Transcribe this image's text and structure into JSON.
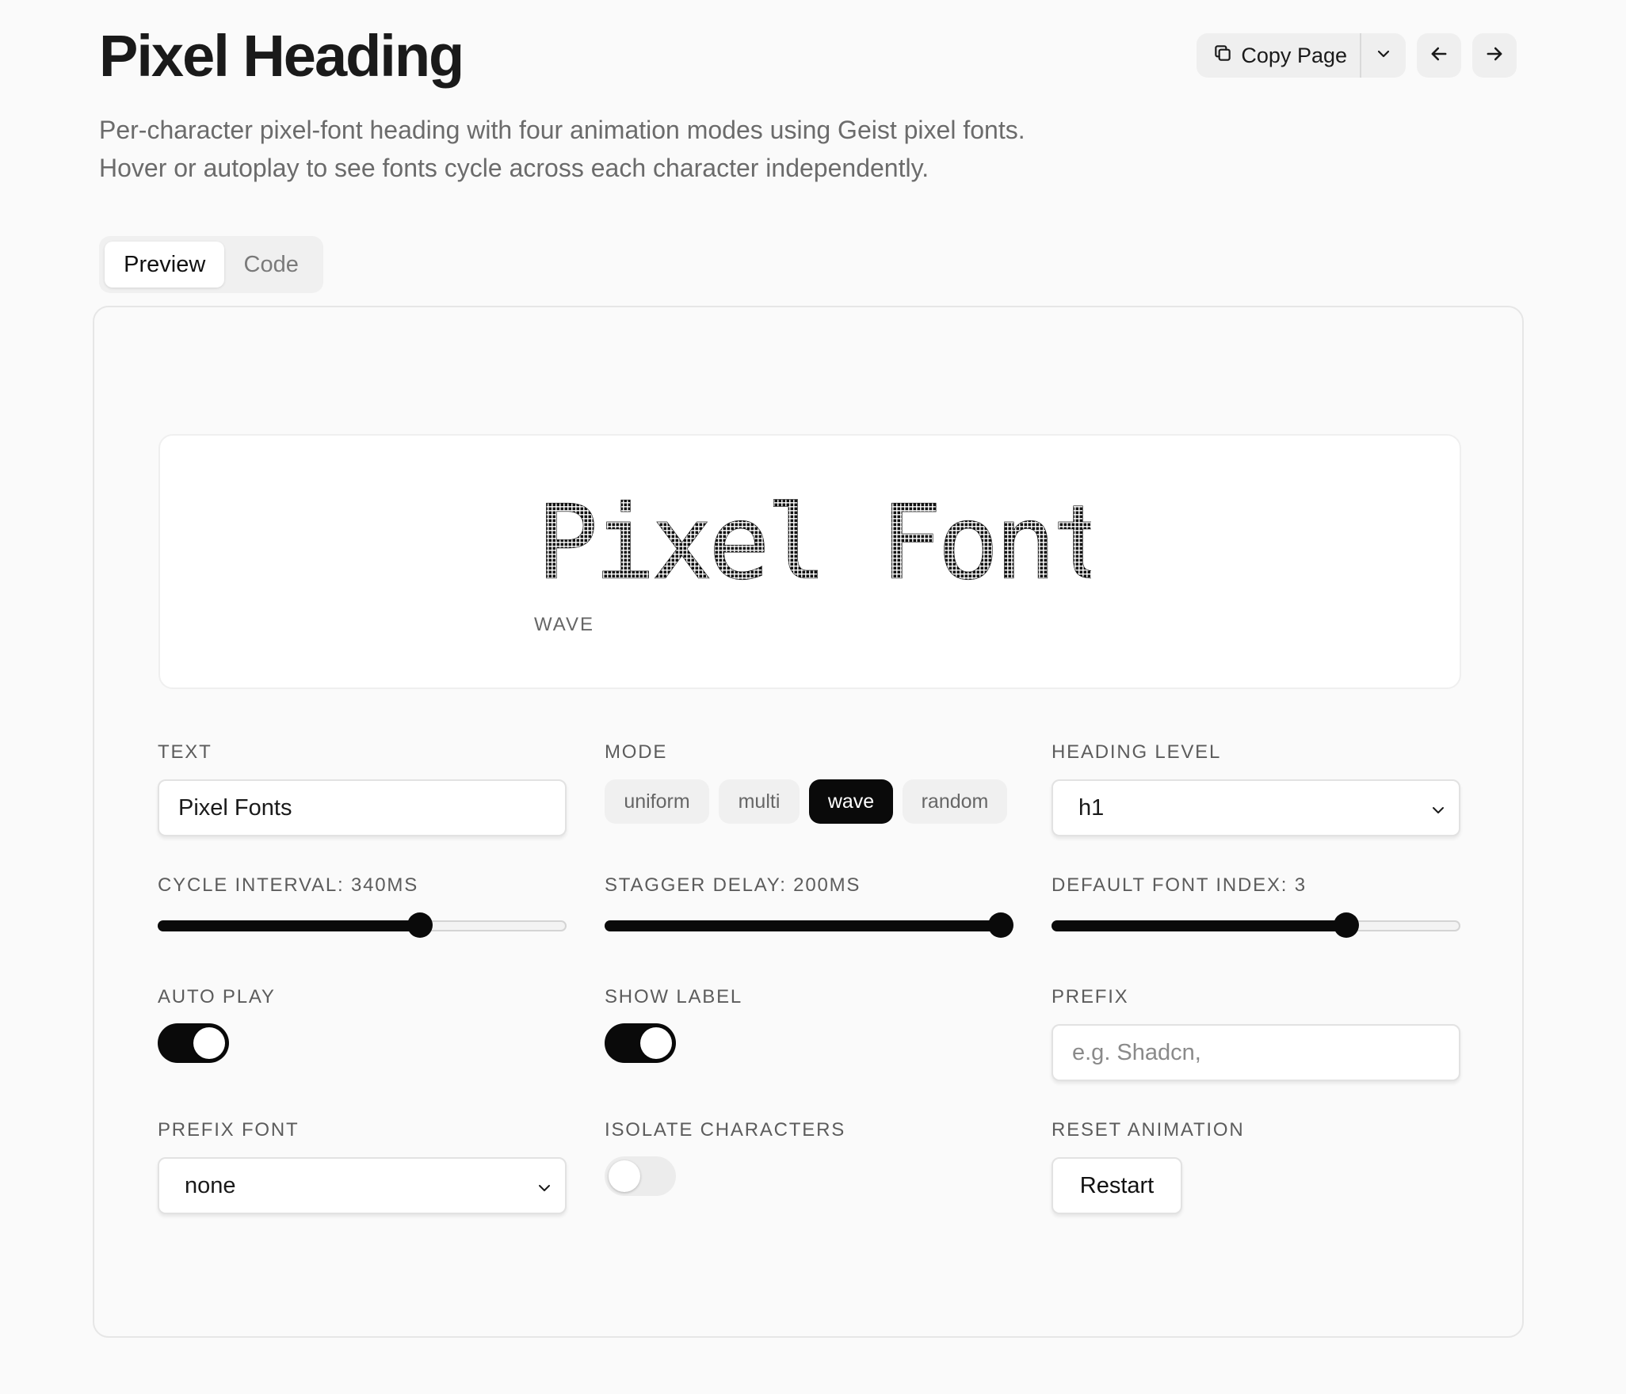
{
  "page": {
    "title": "Pixel Heading",
    "description": "Per-character pixel-font heading with four animation modes using Geist pixel fonts. Hover or autoplay to see fonts cycle across each character independently."
  },
  "actions": {
    "copy_label": "Copy Page",
    "copy_icon": "copy-icon",
    "dropdown_icon": "chevron-down-icon",
    "prev_icon": "arrow-left-icon",
    "next_icon": "arrow-right-icon"
  },
  "tabs": [
    {
      "label": "Preview",
      "active": true
    },
    {
      "label": "Code",
      "active": false
    }
  ],
  "preview": {
    "text": "Pixel Fonts",
    "mode_label": "WAVE"
  },
  "controls": {
    "text": {
      "label": "TEXT",
      "value": "Pixel Fonts"
    },
    "mode": {
      "label": "MODE",
      "options": [
        "uniform",
        "multi",
        "wave",
        "random"
      ],
      "selected": "wave"
    },
    "heading_level": {
      "label": "HEADING LEVEL",
      "value": "h1"
    },
    "cycle_interval": {
      "label": "CYCLE INTERVAL: 340MS",
      "fraction": 0.65
    },
    "stagger_delay": {
      "label": "STAGGER DELAY: 200MS",
      "fraction": 1.0
    },
    "default_font_index": {
      "label": "DEFAULT FONT INDEX: 3",
      "fraction": 0.735
    },
    "auto_play": {
      "label": "AUTO PLAY",
      "on": true
    },
    "show_label": {
      "label": "SHOW LABEL",
      "on": true
    },
    "prefix": {
      "label": "PREFIX",
      "placeholder": "e.g. Shadcn,"
    },
    "prefix_font": {
      "label": "PREFIX FONT",
      "value": "none"
    },
    "isolate_characters": {
      "label": "ISOLATE CHARACTERS",
      "on": false
    },
    "reset_animation": {
      "label": "RESET ANIMATION",
      "button": "Restart"
    }
  },
  "colors": {
    "accent": "#0a0a0a",
    "background": "#fafafa",
    "muted_text": "#6b6b6b"
  }
}
